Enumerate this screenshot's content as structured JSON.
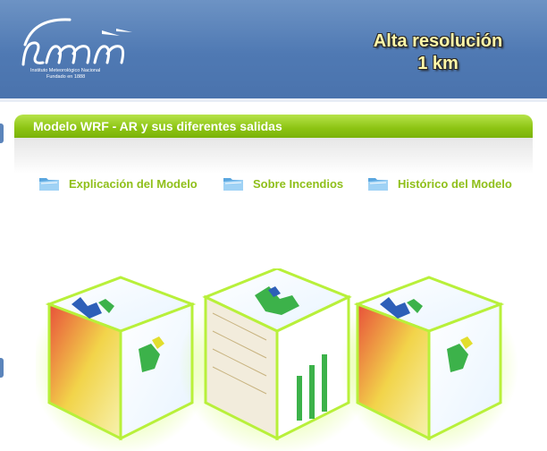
{
  "header": {
    "logo_text": "imn",
    "logo_line1": "Instituto Meteorológico Nacional",
    "logo_line2": "Fundado en 1888",
    "resolution_line1": "Alta resolución",
    "resolution_line2": "1 km",
    "background": "#5a82b9"
  },
  "section": {
    "title": "Modelo WRF - AR y sus diferentes salidas",
    "accent": "#8cc312"
  },
  "nav": {
    "items": [
      {
        "label": "Explicación del Modelo",
        "icon": "folder-icon"
      },
      {
        "label": "Sobre Incendios",
        "icon": "folder-icon"
      },
      {
        "label": "Histórico del Modelo",
        "icon": "folder-icon"
      }
    ],
    "link_color": "#8fbf1a"
  }
}
